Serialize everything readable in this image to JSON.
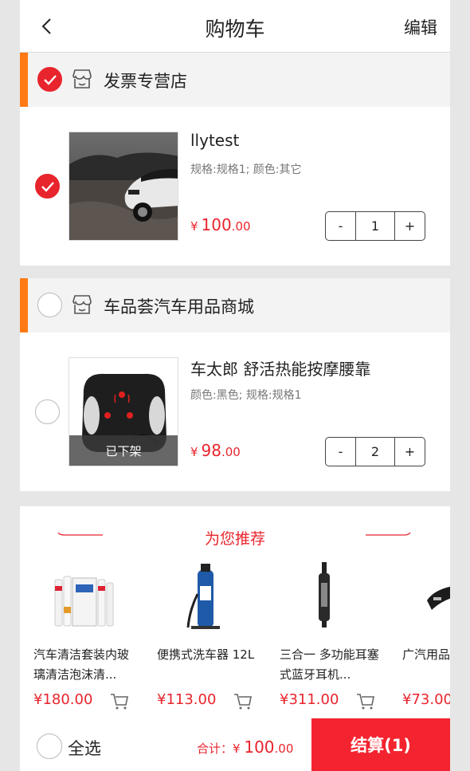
{
  "header": {
    "title": "购物车",
    "edit_label": "编辑"
  },
  "stores": [
    {
      "name": "发票专营店",
      "checked": true,
      "item": {
        "name": "llytest",
        "spec": "规格:规格1;   颜色:其它",
        "currency": "¥",
        "price_int": "100",
        "price_dec": ".00",
        "qty": "1",
        "minus": "-",
        "plus": "+",
        "checked": true
      }
    },
    {
      "name": "车品荟汽车用品商城",
      "checked": false,
      "item": {
        "name": "车太郎 舒活热能按摩腰靠",
        "spec": "颜色:黑色;   规格:规格1",
        "currency": "¥",
        "price_int": "98",
        "price_dec": ".00",
        "qty": "2",
        "minus": "-",
        "plus": "+",
        "off_shelf": "已下架",
        "checked": false
      }
    }
  ],
  "recommend": {
    "title": "为您推荐",
    "items": [
      {
        "name": "汽车清洁套装内玻璃清洁泡沫清...",
        "price": "¥180.00"
      },
      {
        "name": "便携式洗车器 12L",
        "price": "¥113.00"
      },
      {
        "name": "三合一 多功能耳塞式蓝牙耳机...",
        "price": "¥311.00"
      },
      {
        "name": "广汽用品功能安全",
        "price": "¥73.00"
      }
    ]
  },
  "footer": {
    "select_all": "全选",
    "total_label": "合计：",
    "currency": "¥",
    "total_int": "100",
    "total_dec": ".00",
    "checkout": "结算(1)"
  },
  "colors": {
    "accent": "#e8242d",
    "store_bar": "#ff7a14",
    "checkout_bg": "#f3242f"
  }
}
